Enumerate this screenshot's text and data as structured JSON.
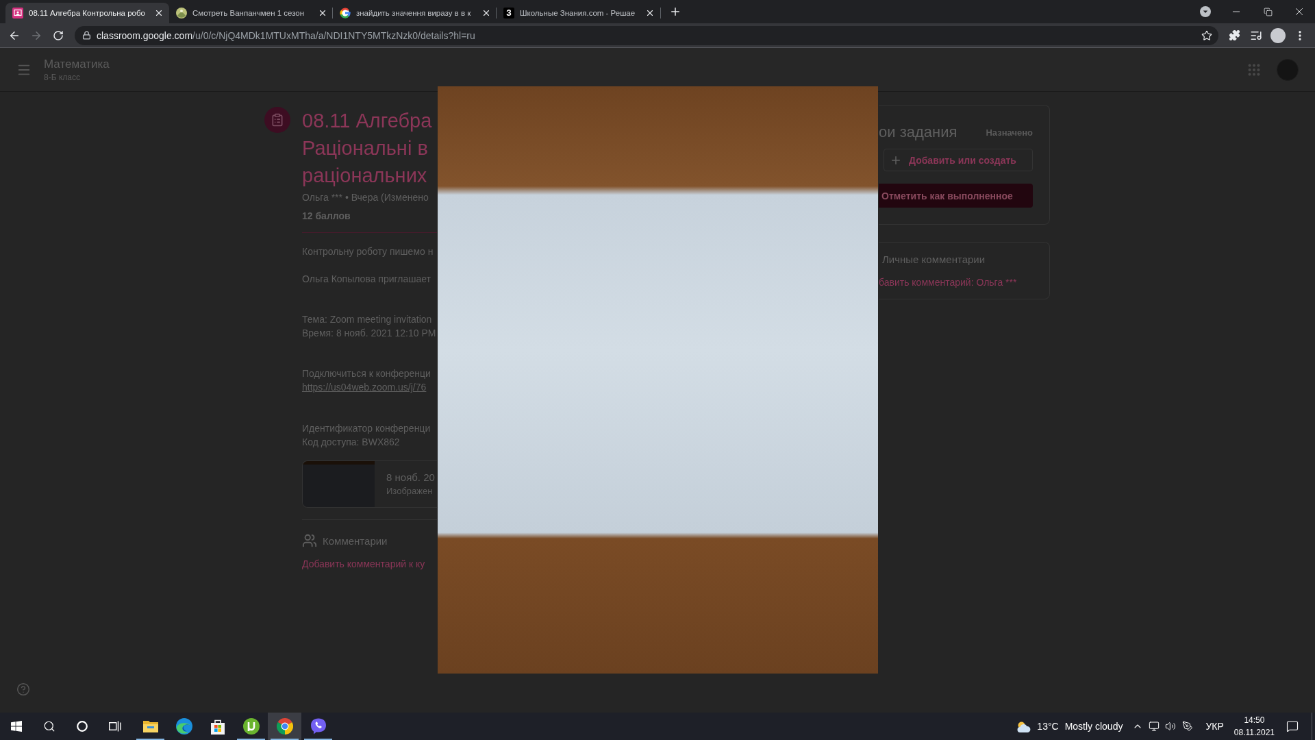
{
  "browser": {
    "tabs": [
      {
        "title": "08.11 Алгебра Контрольна робо",
        "favicon": {
          "kind": "classroom"
        },
        "selected": true
      },
      {
        "title": "Смотреть Ванпанчмен 1 сезон",
        "favicon": {
          "kind": "picture"
        },
        "selected": false
      },
      {
        "title": "знайдить значення виразу в в к",
        "favicon": {
          "kind": "google"
        },
        "selected": false
      },
      {
        "title": "Школьные Знания.com - Решае",
        "favicon": {
          "kind": "letter",
          "text": "З"
        },
        "selected": false
      }
    ],
    "forward_disabled": true,
    "address": {
      "host": "classroom.google.com",
      "path": "/u/0/c/NjQ4MDk1MTUxMTha/a/NDI1NTY5MTkzNzk0/details?hl=ru"
    }
  },
  "header": {
    "course": "Математика",
    "section": "8-Б класс"
  },
  "assignment": {
    "title_lines": [
      "08.11 Алгебра",
      "Раціональні в",
      "раціональних"
    ],
    "meta": "Ольга *** • Вчера (Изменено",
    "points": "12 баллов",
    "description": [
      {
        "lines": [
          {
            "kind": "text",
            "text": "Контрольну роботу пишемо н"
          }
        ]
      },
      {
        "lines": [
          {
            "kind": "text",
            "text": "Ольга Копылова приглашает"
          }
        ]
      },
      {
        "lines": [
          {
            "kind": "text",
            "text": "Тема: Zoom meeting invitation"
          },
          {
            "kind": "text",
            "text": "Время: 8 нояб. 2021 12:10 PM"
          }
        ]
      },
      {
        "lines": [
          {
            "kind": "text",
            "text": "Подключиться к конференци"
          },
          {
            "kind": "link",
            "text": "https://us04web.zoom.us/j/76"
          }
        ]
      },
      {
        "lines": [
          {
            "kind": "text",
            "text": "Идентификатор конференци"
          },
          {
            "kind": "text",
            "text": "Код доступа: BWX862"
          }
        ]
      }
    ],
    "attachment": {
      "title": "8 нояб. 20",
      "subtitle": "Изображен"
    },
    "comments_label": "Комментарии",
    "add_comment": "Добавить комментарий к ку"
  },
  "your_work": {
    "title": "ои задания",
    "status": "Назначено",
    "add_button": "Добавить или создать",
    "done_button": "Отметить как выполненное"
  },
  "private_comments": {
    "title": "Личные комментарии",
    "add_comment": "бавить комментарий: Ольга ***"
  },
  "taskbar": {
    "apps": [
      {
        "kind": "explorer",
        "running": true,
        "selected": false
      },
      {
        "kind": "edge",
        "running": false,
        "selected": false
      },
      {
        "kind": "store",
        "running": false,
        "selected": false
      },
      {
        "kind": "torrent",
        "running": true,
        "selected": false
      },
      {
        "kind": "chrome",
        "running": true,
        "selected": true
      },
      {
        "kind": "viber",
        "running": true,
        "selected": false
      }
    ],
    "weather": {
      "temperature": "13°C",
      "condition": "Mostly cloudy"
    },
    "language": "УКР",
    "time": "14:50",
    "date": "08.11.2021"
  }
}
